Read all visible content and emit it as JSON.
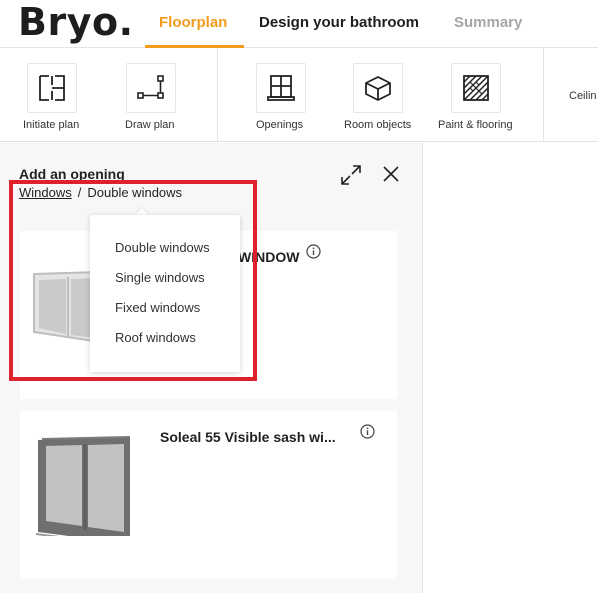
{
  "app": {
    "logo": "Bryo."
  },
  "tabs": [
    {
      "label": "Floorplan",
      "active": true
    },
    {
      "label": "Design your bathroom",
      "active": false
    },
    {
      "label": "Summary",
      "active": false
    }
  ],
  "toolbar": {
    "tools": [
      {
        "label": "Initiate plan",
        "icon": "initiate-plan-icon"
      },
      {
        "label": "Draw plan",
        "icon": "draw-plan-icon"
      },
      {
        "label": "Openings",
        "icon": "window-icon"
      },
      {
        "label": "Room objects",
        "icon": "cube-icon"
      },
      {
        "label": "Paint & flooring",
        "icon": "flooring-pattern-icon"
      }
    ],
    "ceiling_label": "Ceilin"
  },
  "panel": {
    "title": "Add an opening",
    "breadcrumb": {
      "parent": "Windows",
      "separator": "/",
      "current": "Double windows"
    },
    "products": [
      {
        "title": "WINDOW"
      },
      {
        "title": "Soleal 55 Visible sash wi..."
      }
    ]
  },
  "dropdown": {
    "options": [
      "Double windows",
      "Single windows",
      "Fixed windows",
      "Roof windows"
    ]
  },
  "colors": {
    "accent": "#f39b1c",
    "highlight": "#e0202a",
    "panel_bg": "#f7f7f7"
  }
}
